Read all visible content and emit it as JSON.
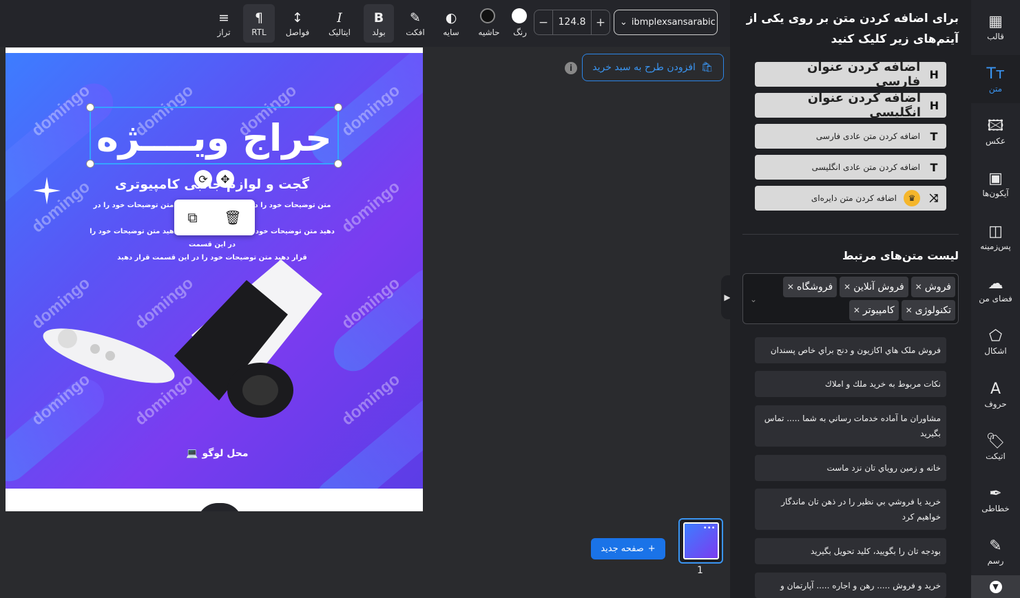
{
  "toolbar": {
    "font": "ibmplexsansarabic",
    "font_size": "124.8",
    "minus": "−",
    "plus": "+",
    "tools": [
      {
        "label": "تراز",
        "icon": "≡"
      },
      {
        "label": "RTL",
        "icon": "¶"
      },
      {
        "label": "فواصل",
        "icon": "↕"
      },
      {
        "label": "ایتالیک",
        "icon": "I"
      },
      {
        "label": "بولد",
        "icon": "B"
      },
      {
        "label": "افکت",
        "icon": "✎"
      },
      {
        "label": "سایه",
        "icon": "◐"
      },
      {
        "label": "حاشیه",
        "icon": ""
      },
      {
        "label": "رنگ",
        "icon": ""
      }
    ]
  },
  "canvas": {
    "add_to_cart": "افزودن طرح به سبد خرید",
    "info": "i",
    "design": {
      "headline": "حراج ویــــژه",
      "subhead": "گجت و لوازم جانبی کامپیوتری",
      "body_lines": [
        "متن توضیحات خود را در این قسمت قرار دهید متن توضیحات خود را در این قسمت قرار",
        "دهید متن توضیحات خود را در این قسمت قرار دهید متن توضیحات خود را در این قسمت",
        "قرار دهید متن توضیحات خود را در این قسمت قرار دهید"
      ],
      "logo_label": "محل لوگو",
      "watermark": "domingo"
    }
  },
  "bottom": {
    "new_page": "صفحه جدید",
    "page_number": "1"
  },
  "panel": {
    "title": "برای اضافه کردن متن بر روی یکی از آیتم‌های زیر کلیک کنید",
    "add_buttons": [
      {
        "label": "اضافه کردن عنوان فارسی",
        "icon": "H",
        "big": true
      },
      {
        "label": "اضافه کردن عنوان انگلیسی",
        "icon": "H",
        "big": true
      },
      {
        "label": "اضافه کردن متن عادی فارسی",
        "icon": "T",
        "big": false
      },
      {
        "label": "اضافه کردن متن عادی انگلیسی",
        "icon": "T",
        "big": false
      },
      {
        "label": "اضافه کردن متن دایره‌ای",
        "icon": "⤨",
        "big": false,
        "premium": true
      }
    ],
    "related_title": "لیست متن‌های مرتبط",
    "tags": [
      "فروش",
      "فروش آنلاین",
      "فروشگاه",
      "تکنولوژی",
      "کامپیوتر"
    ],
    "related": [
      "فروش ملک هاي اكازيون و دنج براي خاص پسندان",
      "نكات مربوط به خريد ملك و املاك",
      "مشاوران ما آماده خدمات رساني به شما ..... تماس بگيريد",
      "خانه و زمين روياي تان نزد ماست",
      "خريد يا فروشي بي نظير را در ذهن تان ماندگار خواهيم كرد",
      "بودجه تان را بگوييد، كليد تحويل بگيريد",
      "خريد و فروش ..... رهن و اجاره ..... آپارتمان و"
    ]
  },
  "sidebar": [
    {
      "label": "قالب",
      "icon": "▦"
    },
    {
      "label": "متن",
      "icon": "Tт",
      "active": true
    },
    {
      "label": "عکس",
      "icon": "🖾"
    },
    {
      "label": "آیکون‌ها",
      "icon": "▣"
    },
    {
      "label": "پس‌زمینه",
      "icon": "◫"
    },
    {
      "label": "فضای من",
      "icon": "☁"
    },
    {
      "label": "اشکال",
      "icon": "⬠"
    },
    {
      "label": "حروف",
      "icon": "A"
    },
    {
      "label": "اتیکت",
      "icon": "🏷"
    },
    {
      "label": "خطاطی",
      "icon": "✒"
    },
    {
      "label": "رسم",
      "icon": "✎"
    }
  ],
  "colors": {
    "accent": "#1a73e8",
    "panel_bg": "#1f2024",
    "toolbar_bg": "#24252a",
    "design_gradient_start": "#3d7dff",
    "design_gradient_end": "#7b3cf0"
  }
}
